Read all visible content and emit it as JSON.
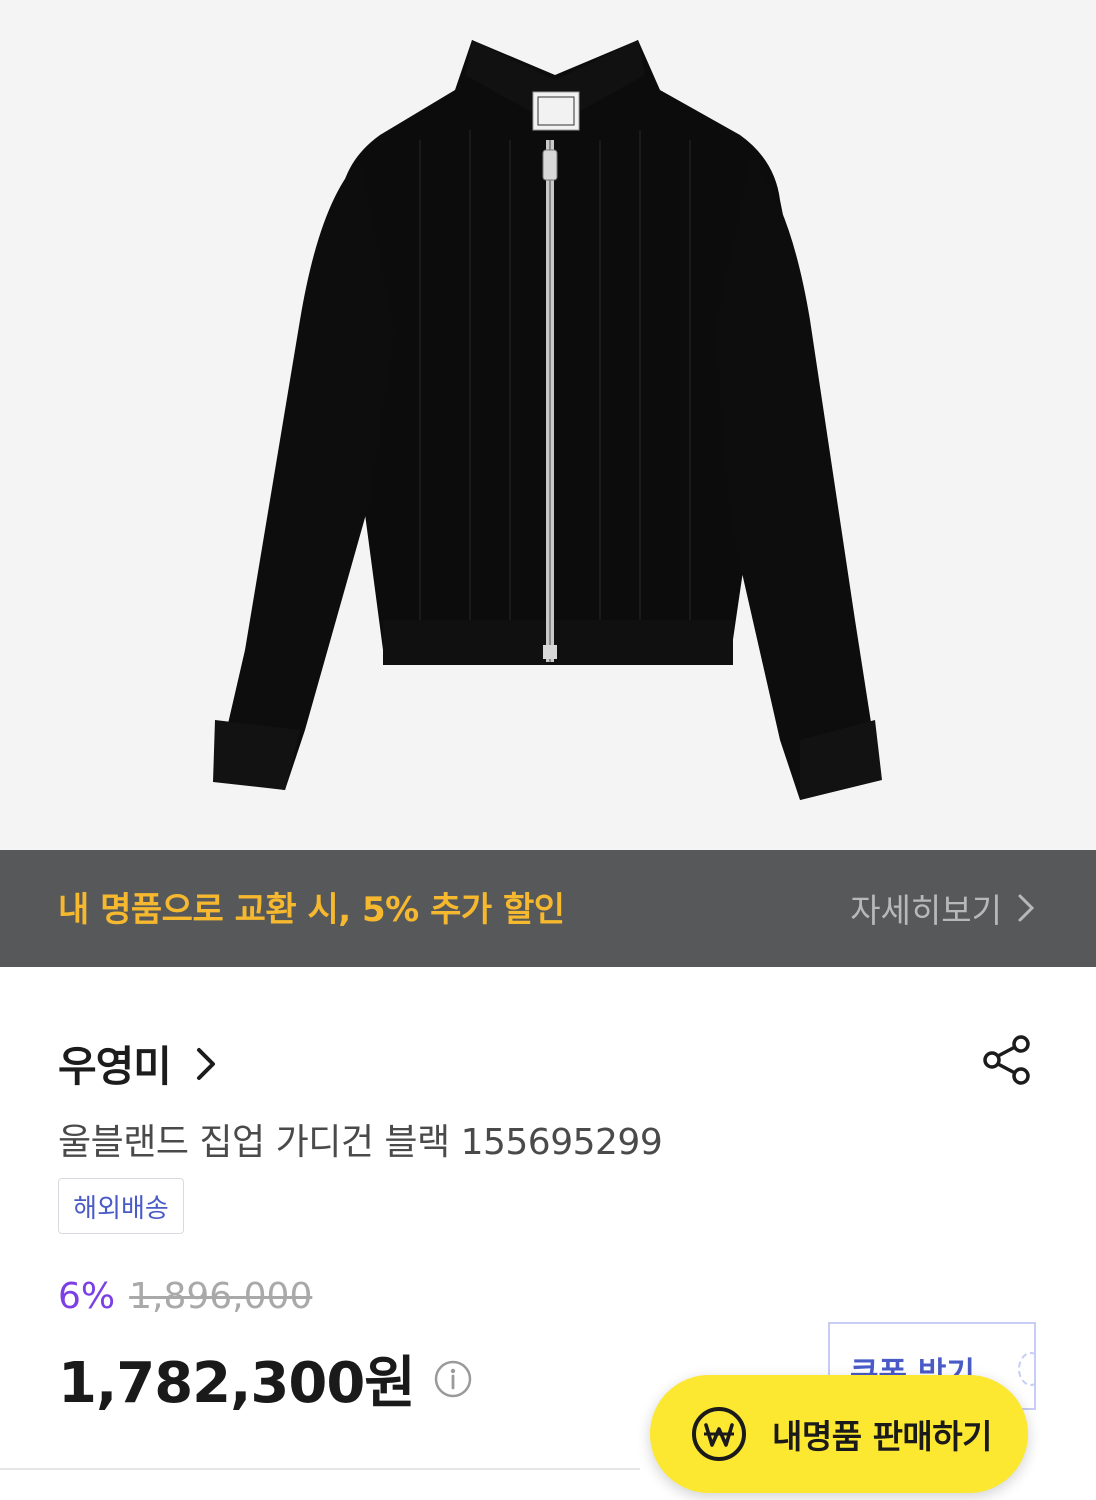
{
  "promo": {
    "text": "내 명품으로 교환 시, 5% 추가 할인",
    "link_label": "자세히보기"
  },
  "product": {
    "brand": "우영미",
    "name": "울블랜드 집업 가디건 블랙 155695299",
    "shipping_badge": "해외배송",
    "discount_rate": "6%",
    "original_price": "1,896,000",
    "final_price": "1,782,300원"
  },
  "coupon": {
    "label": "쿠폰 받기"
  },
  "sell_button": {
    "label": "내명품 판매하기"
  }
}
